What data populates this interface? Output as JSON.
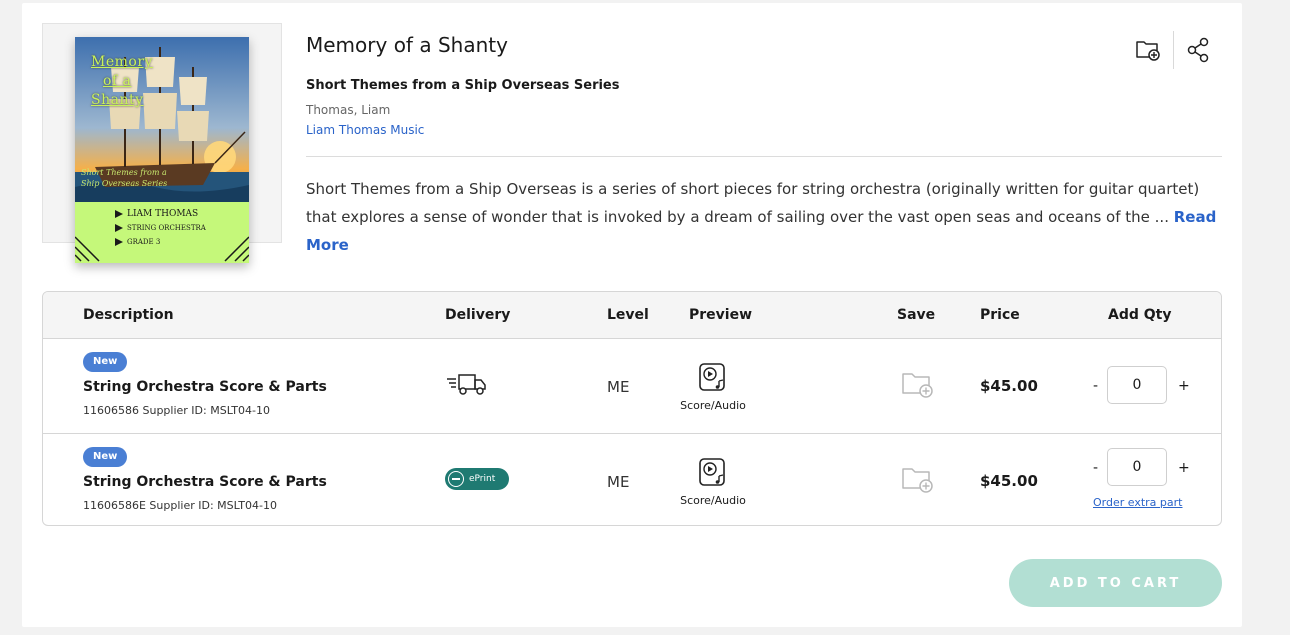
{
  "product": {
    "title": "Memory of a Shanty",
    "series": "Short Themes from a Ship Overseas Series",
    "composer": "Thomas, Liam",
    "publisher": "Liam Thomas Music",
    "description": "Short Themes from a Ship Overseas is a series of short pieces for string orchestra (originally written for guitar quartet) that explores a sense of wonder that is invoked by a dream of sailing over the vast open seas and oceans of the ...",
    "read_more": "Read More"
  },
  "cover": {
    "title_lines": [
      "Memory",
      "of a",
      "Shanty"
    ],
    "series_lines": [
      "Short Themes from a",
      "Ship Overseas Series"
    ],
    "info_lines": [
      "LIAM THOMAS",
      "STRING ORCHESTRA",
      "GRADE 3"
    ],
    "colors": {
      "sky_top": "#3d6fae",
      "sun": "#f5b04a",
      "sea": "#24547a",
      "band": "#c5f87a"
    }
  },
  "actions": {
    "save_icon": "folder-plus-icon",
    "share_icon": "share-icon"
  },
  "table": {
    "headers": {
      "description": "Description",
      "delivery": "Delivery",
      "level": "Level",
      "preview": "Preview",
      "save": "Save",
      "price": "Price",
      "qty": "Add Qty"
    },
    "rows": [
      {
        "badge": "New",
        "name": "String Orchestra Score & Parts",
        "ids": "11606586 Supplier ID: MSLT04-10",
        "delivery_icon": "shipping-truck-icon",
        "level": "ME",
        "preview_label": "Score/Audio",
        "price": "$45.00",
        "qty_minus": "-",
        "qty_value": "0",
        "qty_plus": "+"
      },
      {
        "badge": "New",
        "name": "String Orchestra Score & Parts",
        "ids": "11606586E Supplier ID: MSLT04-10",
        "delivery_label": "ePrint",
        "level": "ME",
        "preview_label": "Score/Audio",
        "price": "$45.00",
        "qty_minus": "-",
        "qty_value": "0",
        "qty_plus": "+",
        "extra_link": "Order extra part"
      }
    ]
  },
  "cart": {
    "button_label": "ADD TO CART",
    "color": "#b2dfd3"
  }
}
